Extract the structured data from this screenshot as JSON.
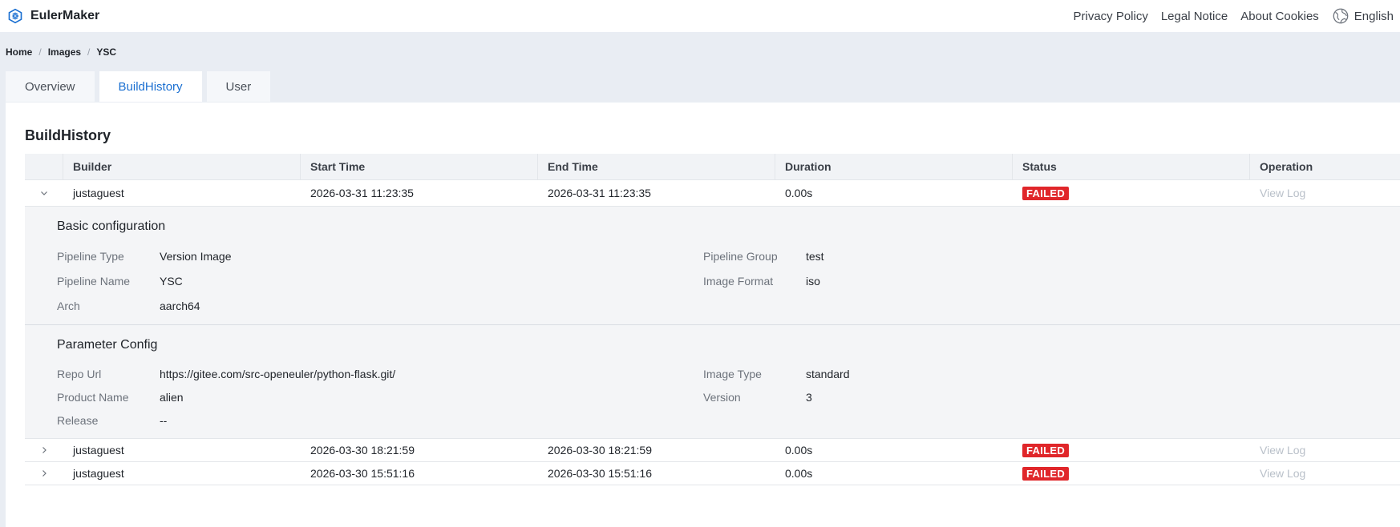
{
  "app": {
    "name": "EulerMaker"
  },
  "header": {
    "links": [
      "Privacy Policy",
      "Legal Notice",
      "About Cookies"
    ],
    "language": "English"
  },
  "breadcrumb": [
    "Home",
    "Images",
    "YSC"
  ],
  "breadcrumb_sep": "/",
  "tabs": [
    {
      "label": "Overview",
      "active": false
    },
    {
      "label": "BuildHistory",
      "active": true
    },
    {
      "label": "User",
      "active": false
    }
  ],
  "page_title": "BuildHistory",
  "table": {
    "headers": [
      "Builder",
      "Start Time",
      "End Time",
      "Duration",
      "Status",
      "Operation"
    ],
    "rows": [
      {
        "builder": "justaguest",
        "start": "2026-03-31 11:23:35",
        "end": "2026-03-31 11:23:35",
        "duration": "0.00s",
        "status": "FAILED",
        "operation": "View Log",
        "expanded": true
      },
      {
        "builder": "justaguest",
        "start": "2026-03-30 18:21:59",
        "end": "2026-03-30 18:21:59",
        "duration": "0.00s",
        "status": "FAILED",
        "operation": "View Log",
        "expanded": false
      },
      {
        "builder": "justaguest",
        "start": "2026-03-30 15:51:16",
        "end": "2026-03-30 15:51:16",
        "duration": "0.00s",
        "status": "FAILED",
        "operation": "View Log",
        "expanded": false
      }
    ]
  },
  "detail": {
    "basic": {
      "title": "Basic configuration",
      "items": [
        {
          "k": "Pipeline Type",
          "v": "Version Image"
        },
        {
          "k": "Pipeline Group",
          "v": "test"
        },
        {
          "k": "Pipeline Name",
          "v": "YSC"
        },
        {
          "k": "Image Format",
          "v": "iso"
        },
        {
          "k": "Arch",
          "v": "aarch64"
        }
      ]
    },
    "params": {
      "title": "Parameter Config",
      "items": [
        {
          "k": "Repo Url",
          "v": "https://gitee.com/src-openeuler/python-flask.git/"
        },
        {
          "k": "Image Type",
          "v": "standard"
        },
        {
          "k": "Product Name",
          "v": "alien"
        },
        {
          "k": "Version",
          "v": "3"
        },
        {
          "k": "Release",
          "v": "--"
        }
      ]
    }
  },
  "colors": {
    "accent": "#1a6fd1",
    "failed": "#e0262a",
    "muted": "#b9c0c9"
  }
}
